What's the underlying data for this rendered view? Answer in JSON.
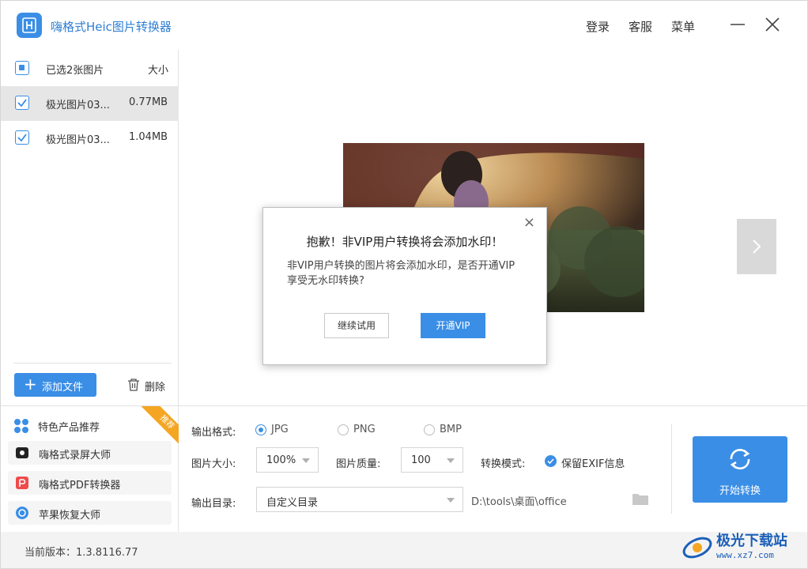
{
  "app": {
    "title": "嗨格式Heic图片转换器",
    "menu": {
      "login": "登录",
      "service": "客服",
      "menu": "菜单"
    }
  },
  "file_list": {
    "header_label": "已选2张图片",
    "header_size": "大小",
    "files": [
      {
        "name": "极光图片03...",
        "size": "0.77MB",
        "checked": true,
        "selected": true
      },
      {
        "name": "极光图片03...",
        "size": "1.04MB",
        "checked": true,
        "selected": false
      }
    ],
    "add_label": "添加文件",
    "delete_label": "删除"
  },
  "dialog": {
    "close": "×",
    "title": "抱歉！非VIP用户转换将会添加水印！",
    "message": "非VIP用户转换的图片将会添加水印，是否开通VIP享受无水印转换?",
    "continue_label": "继续试用",
    "vip_label": "开通VIP"
  },
  "promo": {
    "title": "特色产品推荐",
    "badge": "推荐",
    "items": [
      {
        "label": "嗨格式录屏大师",
        "icon": "screen-recorder-icon"
      },
      {
        "label": "嗨格式PDF转换器",
        "icon": "pdf-converter-icon"
      },
      {
        "label": "苹果恢复大师",
        "icon": "apple-recovery-icon"
      }
    ]
  },
  "settings": {
    "format_label": "输出格式:",
    "formats": [
      "JPG",
      "PNG",
      "BMP"
    ],
    "selected_format": "JPG",
    "size_label": "图片大小:",
    "size_value": "100%",
    "quality_label": "图片质量:",
    "quality_value": "100",
    "mode_label": "转换模式:",
    "mode_option": "保留EXIF信息",
    "dir_label": "输出目录:",
    "dir_value": "自定义目录",
    "dir_path": "D:\\tools\\桌面\\office",
    "start_label": "开始转换"
  },
  "footer": {
    "version_label": "当前版本：1.3.8116.77",
    "watermark_title": "极光下载站",
    "watermark_url": "www.xz7.com"
  },
  "colors": {
    "accent": "#3a8ee6",
    "badge": "#f4a623"
  }
}
